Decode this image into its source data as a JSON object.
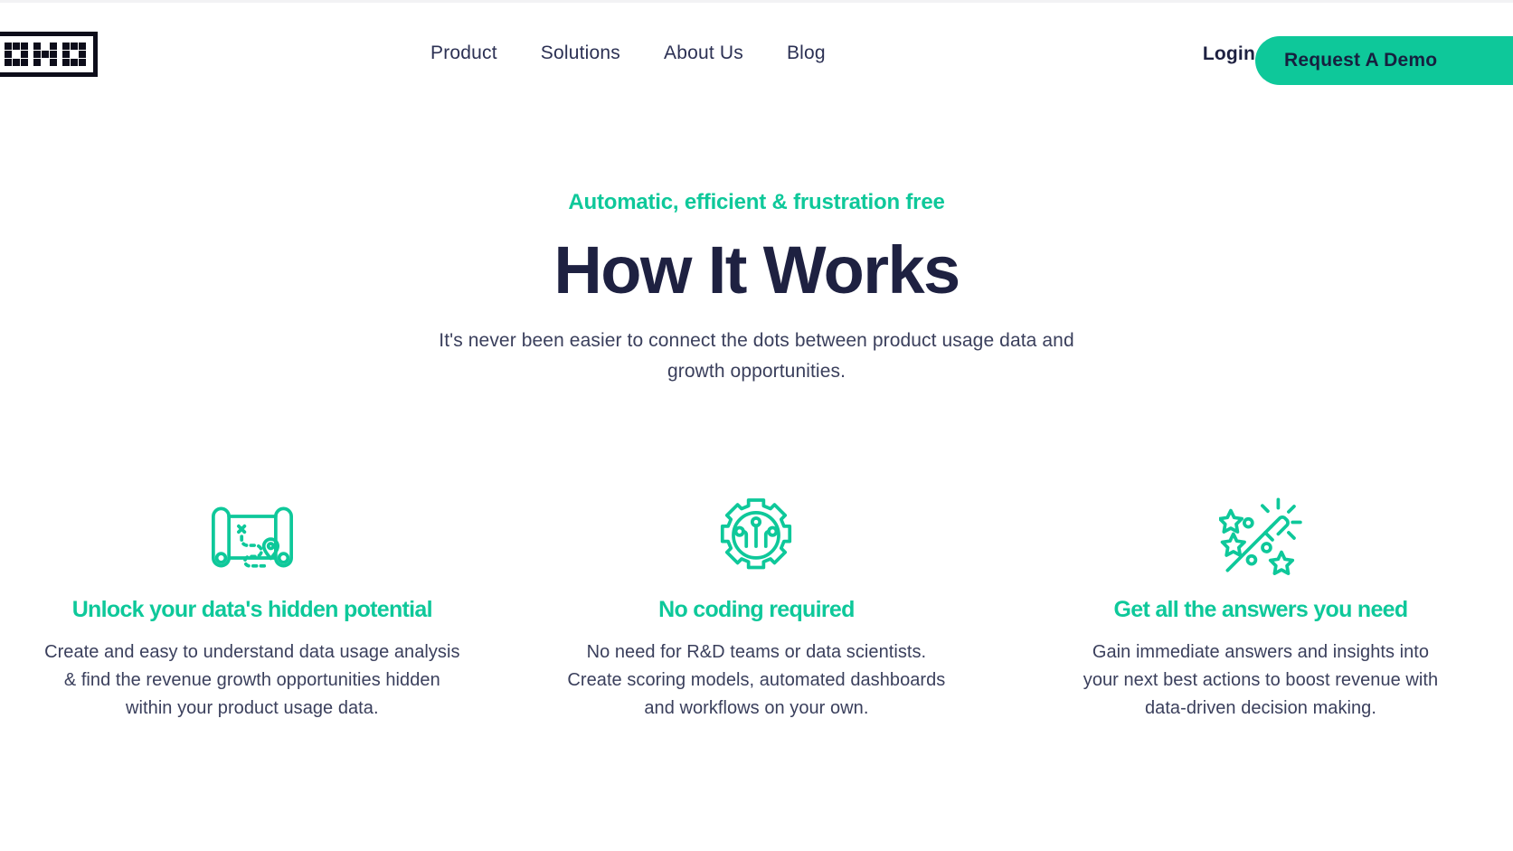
{
  "header": {
    "logo": {
      "name": "oho-logo",
      "letters": [
        "O",
        "H",
        "O"
      ]
    },
    "nav": [
      {
        "label": "Product"
      },
      {
        "label": "Solutions"
      },
      {
        "label": "About Us"
      },
      {
        "label": "Blog"
      }
    ],
    "login_label": "Login",
    "demo_label": "Request A Demo"
  },
  "hero": {
    "eyebrow": "Automatic, efficient & frustration free",
    "title": "How It Works",
    "subtitle": "It's never been easier to connect the dots between product usage data and growth opportunities."
  },
  "features": [
    {
      "icon": "map-scroll-icon",
      "title": "Unlock your data's hidden potential",
      "body": "Create and easy to understand data usage analysis & find the revenue growth opportunities hidden within your product usage data."
    },
    {
      "icon": "gear-circuit-icon",
      "title": "No coding required",
      "body": "No need for R&D teams or data scientists. Create scoring models, automated dashboards and workflows on your own."
    },
    {
      "icon": "magic-wand-icon",
      "title": "Get all the answers you need",
      "body": "Gain immediate answers and insights into your next best actions to boost revenue with data-driven decision making."
    }
  ],
  "colors": {
    "green": "#0ec89a",
    "navy": "#1e2141",
    "body_text": "#3a3f5c",
    "logo_black": "#0d0d1a"
  }
}
